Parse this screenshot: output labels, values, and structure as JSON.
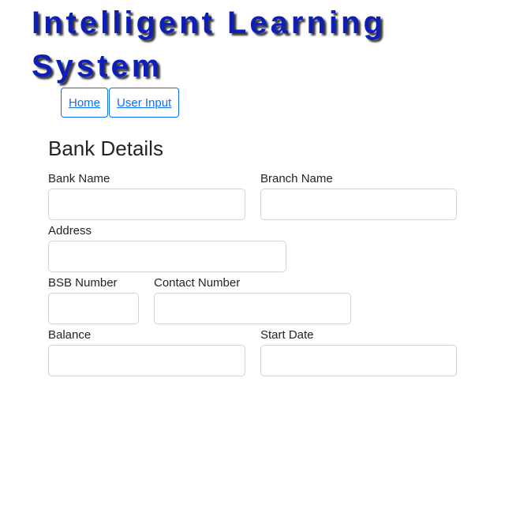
{
  "app": {
    "title_line1": "Intelligent Learning",
    "title_line2": "System"
  },
  "nav": [
    {
      "label": "Home"
    },
    {
      "label": "User Input"
    }
  ],
  "form": {
    "title": "Bank Details",
    "fields": {
      "bank_name": {
        "label": "Bank Name",
        "value": ""
      },
      "branch_name": {
        "label": "Branch Name",
        "value": ""
      },
      "address": {
        "label": "Address",
        "value": ""
      },
      "bsb_number": {
        "label": "BSB Number",
        "value": ""
      },
      "contact_number": {
        "label": "Contact Number",
        "value": ""
      },
      "balance": {
        "label": "Balance",
        "value": ""
      },
      "start_date": {
        "label": "Start Date",
        "value": ""
      }
    }
  },
  "colors": {
    "title": "#0d1fb8",
    "link": "#0d6efd",
    "input_border": "#ced4da"
  }
}
